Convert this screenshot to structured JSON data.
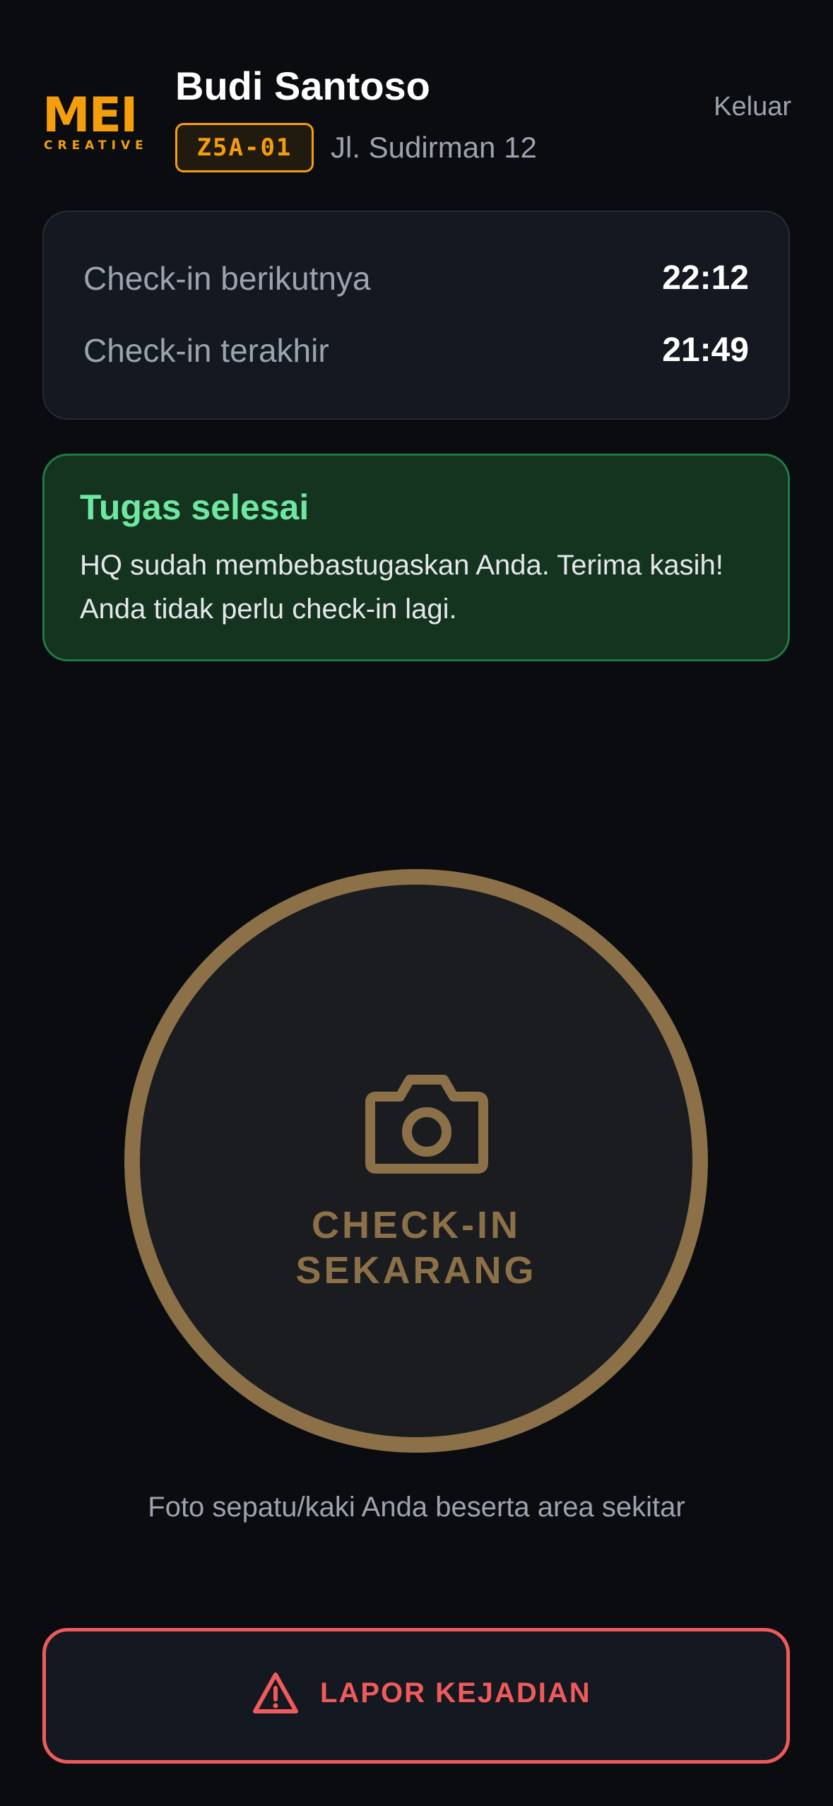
{
  "app": {
    "logo_text": "MEI",
    "logo_subtext": "CREATIVE",
    "brand_color": "#f59e0b"
  },
  "header": {
    "user_name": "Budi Santoso",
    "post_code": "Z5A-01",
    "post_address": "Jl. Sudirman 12",
    "logout_label": "Keluar"
  },
  "schedule": {
    "next_label": "Check-in berikutnya",
    "next_time": "22:12",
    "last_label": "Check-in terakhir",
    "last_time": "21:49"
  },
  "status": {
    "title": "Tugas selesai",
    "message": "HQ sudah membebastugaskan Anda. Terima kasih! Anda tidak perlu check-in lagi.",
    "color": "#6ee7a1"
  },
  "checkin": {
    "label_line1": "CHECK-IN",
    "label_line2": "SEKARANG",
    "icon": "camera-icon",
    "ring_color": "#8b7048"
  },
  "hint": {
    "text": "Foto sepatu/kaki Anda beserta area sekitar"
  },
  "report": {
    "label": "LAPOR KEJADIAN",
    "icon": "warning-icon",
    "color": "#ef5a5a"
  }
}
